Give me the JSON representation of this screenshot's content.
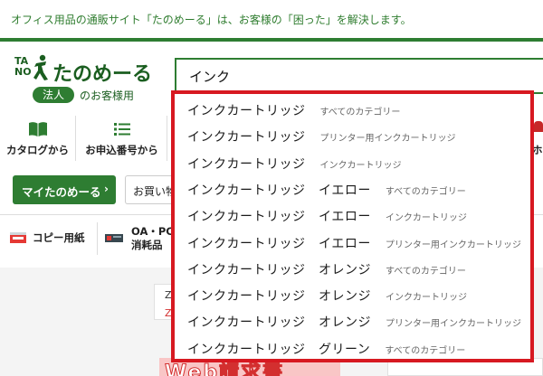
{
  "header": {
    "tagline": "オフィス用品の通販サイト「たのめーる」は、お客様の「困った」を解決します。"
  },
  "logo": {
    "ta": "TA",
    "no": "NO",
    "name": "たのめーる",
    "badge": "法人",
    "sub": "のお客様用"
  },
  "search": {
    "value": "インク"
  },
  "nav": {
    "catalog": "カタログから",
    "order_no": "お申込番号から",
    "right_fragment": "ホ"
  },
  "account": {
    "my_button": "マイたのめーる",
    "my_chevron": "›",
    "shop_button": "お買い物"
  },
  "categories": {
    "copy_paper": "コピー用紙",
    "oa_line1": "OA・PC",
    "oa_line2": "消耗品"
  },
  "promo": {
    "banner_text": "Web請求書",
    "z1": "Z",
    "z2": "Z"
  },
  "suggestions": [
    {
      "main": "インクカートリッジ",
      "category": "すべてのカテゴリー"
    },
    {
      "main": "インクカートリッジ",
      "category": "プリンター用インクカートリッジ"
    },
    {
      "main": "インクカートリッジ",
      "category": "インクカートリッジ"
    },
    {
      "main": "インクカートリッジ　イエロー",
      "category": "すべてのカテゴリー"
    },
    {
      "main": "インクカートリッジ　イエロー",
      "category": "インクカートリッジ"
    },
    {
      "main": "インクカートリッジ　イエロー",
      "category": "プリンター用インクカートリッジ"
    },
    {
      "main": "インクカートリッジ　オレンジ",
      "category": "すべてのカテゴリー"
    },
    {
      "main": "インクカートリッジ　オレンジ",
      "category": "インクカートリッジ"
    },
    {
      "main": "インクカートリッジ　オレンジ",
      "category": "プリンター用インクカートリッジ"
    },
    {
      "main": "インクカートリッジ　グリーン",
      "category": "すべてのカテゴリー"
    }
  ],
  "colors": {
    "brand_green": "#2e7d32",
    "highlight_red": "#d71921"
  },
  "icons": {
    "catalog": "book-icon",
    "order_no": "list-icon",
    "copy_paper": "paper-ream-icon",
    "oa": "ink-cartridge-icon"
  }
}
